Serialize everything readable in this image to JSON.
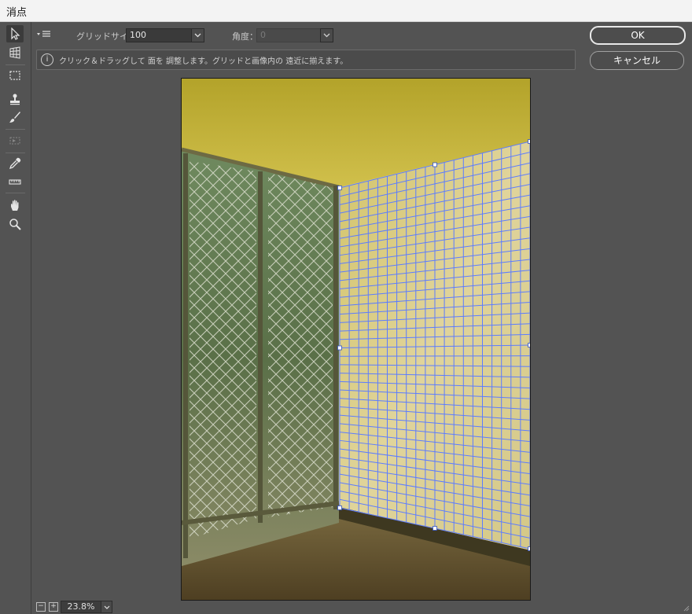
{
  "window": {
    "title": "消点"
  },
  "toolbar": {
    "tools": [
      {
        "name": "edit-plane-tool-icon",
        "active": true
      },
      {
        "name": "create-plane-tool-icon"
      },
      {
        "name": "marquee-tool-icon"
      },
      {
        "name": "stamp-tool-icon"
      },
      {
        "name": "brush-tool-icon"
      },
      {
        "name": "transform-tool-icon"
      },
      {
        "name": "eyedropper-tool-icon"
      },
      {
        "name": "measure-tool-icon"
      },
      {
        "name": "hand-tool-icon"
      },
      {
        "name": "zoom-tool-icon"
      }
    ]
  },
  "options": {
    "grid_size_label": "グリッドサイズ：",
    "grid_size_value": "100",
    "angle_label": "角度：",
    "angle_value": "0"
  },
  "hint": {
    "icon": "i",
    "text": "クリック＆ドラッグして 面を 調整します。グリッドと画像内の 遠近に揃えます。"
  },
  "buttons": {
    "ok": "OK",
    "cancel": "キャンセル"
  },
  "status": {
    "zoom_out": "−",
    "zoom_in": "+",
    "zoom_value": "23.8%"
  },
  "colors": {
    "grid": "#5c7cff",
    "background": "#535353"
  }
}
